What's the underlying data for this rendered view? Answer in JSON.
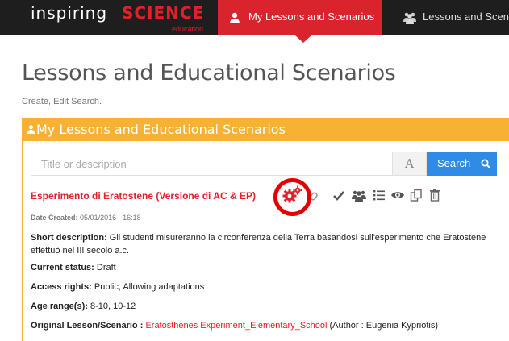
{
  "nav": {
    "logo_main": "inspiring",
    "logo_science": "SCIENCE",
    "logo_sub": "education",
    "tabs": [
      {
        "label": "My Lessons and Scenarios",
        "active": true
      },
      {
        "label": "Lessons and Scena",
        "active": false
      }
    ]
  },
  "header": {
    "title": "Lessons and Educational Scenarios",
    "subtitle": "Create, Edit Search."
  },
  "panel": {
    "title": "My Lessons and Educational Scenarios",
    "search": {
      "placeholder": "Title or description",
      "font_toggle": "A",
      "button_label": "Search"
    },
    "lesson": {
      "title": "Esperimento di Eratostene (Versione di AC & EP)",
      "date_label": "Date Created:",
      "date_value": "05/01/2016 - 16:18",
      "short_desc_label": "Short description:",
      "short_desc_value": "Gli studenti misureranno la circonferenza della Terra basandosi sull'esperimento che Eratostene effettuò nel III secolo a.c.",
      "status_label": "Current status:",
      "status_value": "Draft",
      "access_label": "Access rights:",
      "access_value": "Public, Allowing adaptations",
      "age_label": "Age range(s):",
      "age_value": "8-10, 10-12",
      "original_label": "Original Lesson/Scenario :",
      "original_link": "Eratosthenes Experiment_Elementary_School",
      "original_author": "(Author : Eugenia Kypriotis)"
    },
    "actions": [
      "settings-icon",
      "link-icon",
      "check-icon",
      "users-icon",
      "list-icon",
      "eye-icon",
      "copy-icon",
      "trash-icon"
    ]
  },
  "colors": {
    "nav_bg": "#1e1e1e",
    "brand_red": "#e2202b",
    "active_tab": "#d9232d",
    "panel_header": "#f7b133",
    "search_button": "#2f8be6",
    "highlight_circle": "#e30000"
  }
}
